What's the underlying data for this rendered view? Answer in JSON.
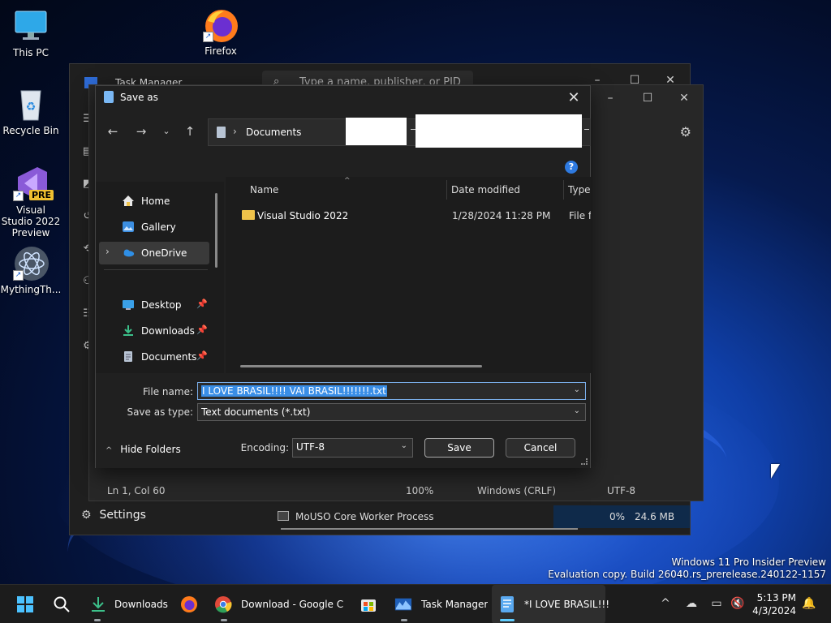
{
  "desktop": {
    "icons": [
      {
        "label": "This PC",
        "icon": "monitor-icon"
      },
      {
        "label": "Firefox",
        "icon": "firefox-icon"
      },
      {
        "label": "Recycle Bin",
        "icon": "recycle-bin-icon"
      },
      {
        "label": "Visual Studio 2022 Preview",
        "badge": "PRE",
        "icon": "visual-studio-icon"
      },
      {
        "label": "MythingTh...",
        "icon": "atom-icon"
      }
    ]
  },
  "task_manager": {
    "title": "Task Manager",
    "search_placeholder": "Type a name, publisher, or PID",
    "settings_label": "Settings",
    "row": {
      "name": "MoUSO Core Worker Process",
      "cpu": "0%",
      "memory": "24.6 MB"
    }
  },
  "notepad": {
    "status": {
      "position": "Ln 1, Col 60",
      "zoom": "100%",
      "line_ending": "Windows (CRLF)",
      "encoding": "UTF-8"
    }
  },
  "save_dialog": {
    "title": "Save as",
    "breadcrumb": "Documents",
    "nav_items": [
      {
        "label": "Home",
        "icon": "home-icon"
      },
      {
        "label": "Gallery",
        "icon": "gallery-icon"
      },
      {
        "label": "OneDrive",
        "icon": "cloud-icon"
      },
      {
        "label": "Desktop",
        "icon": "desktop-icon"
      },
      {
        "label": "Downloads",
        "icon": "download-icon"
      },
      {
        "label": "Documents",
        "icon": "documents-icon"
      }
    ],
    "columns": [
      "Name",
      "Date modified",
      "Type"
    ],
    "files": [
      {
        "name": "Visual Studio 2022",
        "date": "1/28/2024 11:28 PM",
        "type": "File folder"
      }
    ],
    "file_name_label": "File name:",
    "file_name_value": "I LOVE BRASIL!!!! VAI BRASIL!!!!!!!.txt",
    "save_type_label": "Save as type:",
    "save_type_value": "Text documents (*.txt)",
    "hide_folders_label": "Hide Folders",
    "encoding_label": "Encoding:",
    "encoding_value": "UTF-8",
    "save_button": "Save",
    "cancel_button": "Cancel",
    "help": "?"
  },
  "watermark": {
    "line1": "Windows 11 Pro Insider Preview",
    "line2": "Evaluation copy. Build 26040.rs_prerelease.240122-1157"
  },
  "taskbar": {
    "downloads": "Downloads",
    "chrome": "Download - Google Chi",
    "task_manager": "Task Manager",
    "notepad": "*I LOVE BRASIL!!!",
    "time": "5:13 PM",
    "date": "4/3/2024"
  },
  "colors": {
    "accent": "#3a8ee6",
    "active_indicator": "#60cdff",
    "folder": "#f0c34a"
  }
}
